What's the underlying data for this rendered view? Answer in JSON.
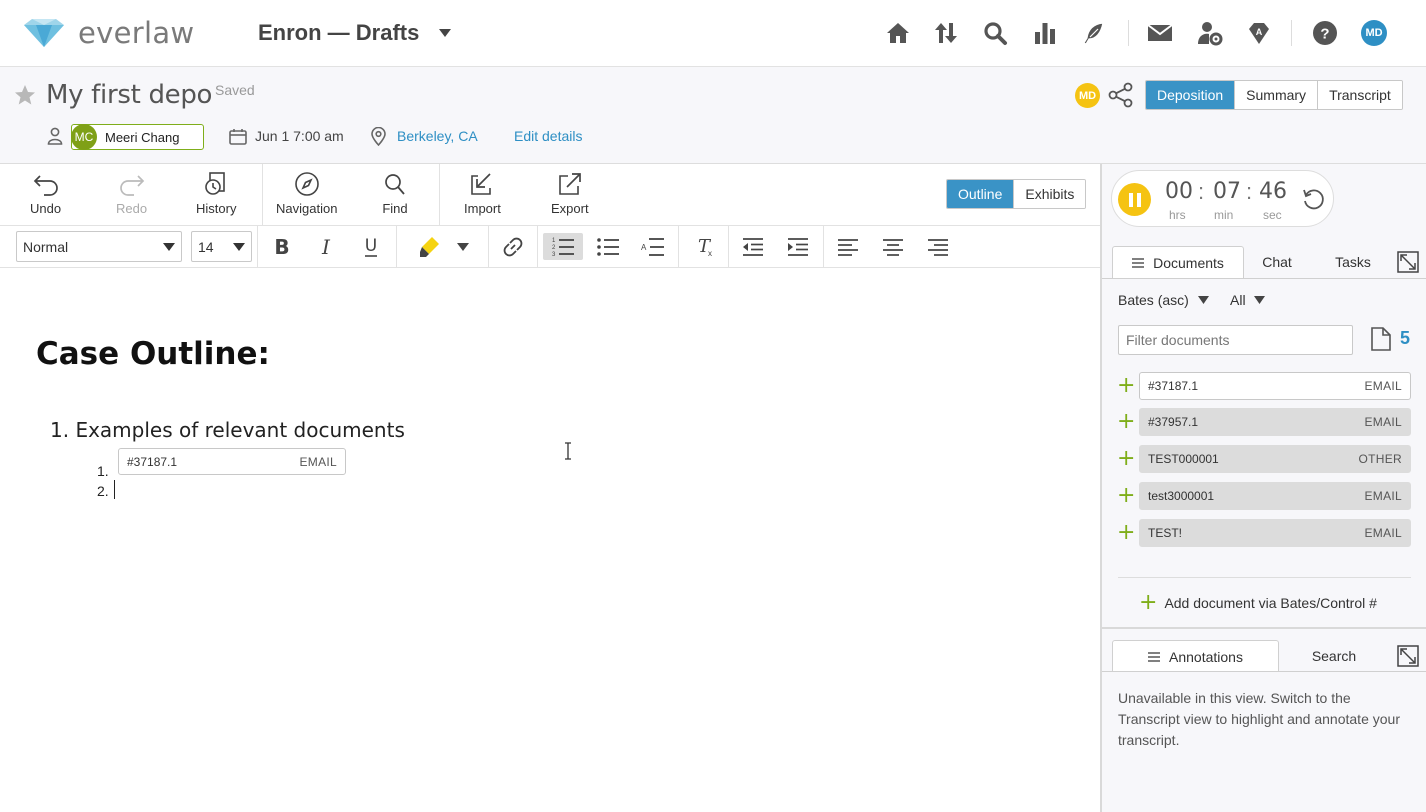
{
  "app": {
    "logo_text": "everlaw",
    "project_title": "Enron — Drafts",
    "nav_icons": [
      "home-icon",
      "upload-download-icon",
      "search-icon",
      "analytics-icon",
      "feather-icon",
      "mail-icon",
      "admin-gear-icon",
      "gem-icon",
      "help-icon"
    ],
    "user_initials": "MD"
  },
  "depo": {
    "title": "My first depo",
    "status": "Saved",
    "witness_initials": "MC",
    "witness_name": "Meeri Chang",
    "date": "Jun 1 7:00 am",
    "location": "Berkeley, CA",
    "edit_details": "Edit details",
    "collaborator_initials": "MD",
    "view_tabs": [
      "Deposition",
      "Summary",
      "Transcript"
    ],
    "active_view": "Deposition"
  },
  "toolbar": {
    "undo": "Undo",
    "redo": "Redo",
    "history": "History",
    "navigation": "Navigation",
    "find": "Find",
    "import": "Import",
    "export": "Export",
    "outline_tab": "Outline",
    "exhibits_tab": "Exhibits",
    "style_value": "Normal",
    "size_value": "14"
  },
  "editor": {
    "heading": "Case Outline:",
    "item1": "1. Examples of relevant documents",
    "sub1_num": "1.",
    "sub2_num": "2.",
    "embedded_doc": {
      "id": "#37187.1",
      "type": "EMAIL"
    }
  },
  "timer": {
    "hrs": "00",
    "min": "07",
    "sec": "46",
    "hrs_label": "hrs",
    "min_label": "min",
    "sec_label": "sec",
    "sep": ":"
  },
  "docs_panel": {
    "tabs": [
      "Documents",
      "Chat",
      "Tasks"
    ],
    "sort": "Bates (asc)",
    "filter_all": "All",
    "filter_placeholder": "Filter documents",
    "count": "5",
    "documents": [
      {
        "id": "#37187.1",
        "type": "EMAIL"
      },
      {
        "id": "#37957.1",
        "type": "EMAIL"
      },
      {
        "id": "TEST000001",
        "type": "OTHER"
      },
      {
        "id": "test3000001",
        "type": "EMAIL"
      },
      {
        "id": "TEST!",
        "type": "EMAIL"
      }
    ],
    "add_doc": "Add document via Bates/Control #"
  },
  "annotations_panel": {
    "tabs": [
      "Annotations",
      "Search"
    ],
    "message": "Unavailable in this view. Switch to the Transcript view to highlight and annotate your transcript."
  },
  "colors": {
    "accent": "#3a93c6",
    "link": "#2e8fc4",
    "timer_yellow": "#f5c312",
    "add_green": "#7fae1a"
  }
}
